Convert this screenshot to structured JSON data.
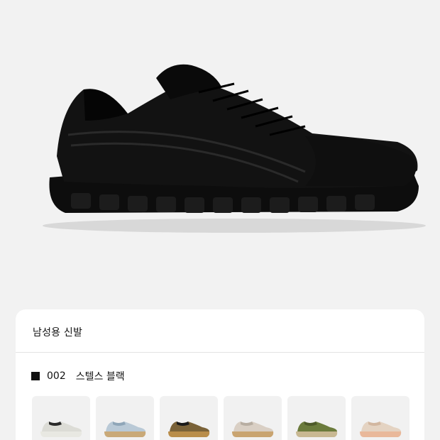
{
  "product": {
    "category": "남성용 신발",
    "variant": {
      "code": "002",
      "name": "스텔스 블랙",
      "swatch_color": "#111111"
    },
    "colorways": [
      {
        "upper": "#dcdcd6",
        "accent": "#2a2a2a",
        "sole": "#e8e8e2"
      },
      {
        "upper": "#b9c9d6",
        "accent": "#8fa6b8",
        "sole": "#c9a978"
      },
      {
        "upper": "#7a6238",
        "accent": "#1a1a1a",
        "sole": "#b98d4a"
      },
      {
        "upper": "#d9cfc4",
        "accent": "#b8aea2",
        "sole": "#c9a470"
      },
      {
        "upper": "#6b7b3c",
        "accent": "#4e5a2a",
        "sole": "#c8b892"
      },
      {
        "upper": "#e4d3c2",
        "accent": "#d2b7a0",
        "sole": "#e9b89a"
      }
    ]
  }
}
